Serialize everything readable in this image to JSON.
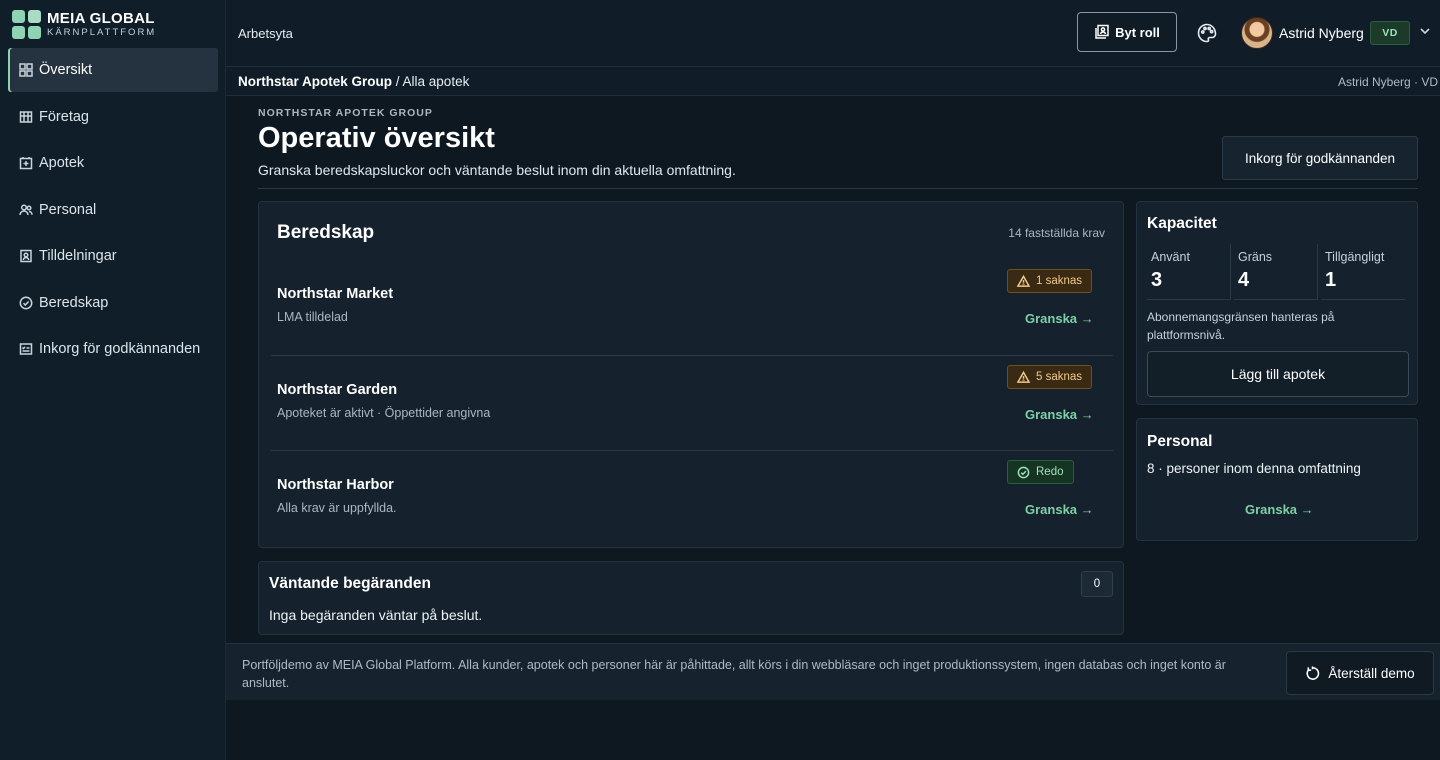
{
  "brand": {
    "name": "MEIA GLOBAL",
    "subtitle": "KÄRNPLATTFORM"
  },
  "sidebar": {
    "items": [
      {
        "label": "Översikt",
        "icon": "grid-icon",
        "active": true
      },
      {
        "label": "Företag",
        "icon": "building-icon"
      },
      {
        "label": "Apotek",
        "icon": "pharmacy-icon"
      },
      {
        "label": "Personal",
        "icon": "users-icon"
      },
      {
        "label": "Tilldelningar",
        "icon": "badge-icon"
      },
      {
        "label": "Beredskap",
        "icon": "check-circle-icon"
      },
      {
        "label": "Inkorg för godkännanden",
        "icon": "inbox-icon"
      }
    ]
  },
  "topbar": {
    "title": "Arbetsyta",
    "switch_role_label": "Byt roll",
    "user_name": "Astrid Nyberg",
    "user_role": "VD"
  },
  "breadcrumb": {
    "org": "Northstar Apotek Group",
    "separator": " / ",
    "current": "Alla apotek",
    "right": "Astrid Nyberg · VD"
  },
  "header": {
    "eyebrow": "NORTHSTAR APOTEK GROUP",
    "title": "Operativ översikt",
    "subtitle": "Granska beredskapsluckor och väntande beslut inom din aktuella omfattning.",
    "inbox_button": "Inkorg för godkännanden"
  },
  "readiness": {
    "title": "Beredskap",
    "requirements": "14 fastställda krav",
    "rows": [
      {
        "name": "Northstar Market",
        "desc": "LMA tilldelad",
        "badge": "1 saknas",
        "status": "warn",
        "link": "Granska →"
      },
      {
        "name": "Northstar Garden",
        "desc": "Apoteket är aktivt · Öppettider angivna",
        "badge": "5 saknas",
        "status": "warn",
        "link": "Granska →"
      },
      {
        "name": "Northstar Harbor",
        "desc": "Alla krav är uppfyllda.",
        "badge": "Redo",
        "status": "ok",
        "link": "Granska →"
      }
    ]
  },
  "pending": {
    "title": "Väntande begäranden",
    "count": "0",
    "empty": "Inga begäranden väntar på beslut."
  },
  "capacity": {
    "title": "Kapacitet",
    "stats": [
      {
        "label": "Använt",
        "value": "3"
      },
      {
        "label": "Gräns",
        "value": "4"
      },
      {
        "label": "Tillgängligt",
        "value": "1"
      }
    ],
    "note": "Abonnemangsgränsen hanteras på plattformsnivå.",
    "add_button": "Lägg till apotek"
  },
  "staff": {
    "title": "Personal",
    "count": "8 · personer inom denna omfattning",
    "link": "Granska →"
  },
  "footer": {
    "text": "Portföljdemo av MEIA Global Platform. Alla kunder, apotek och personer här är påhittade, allt körs i din webbläsare och inget produktionssystem, ingen databas och inget konto är anslutet.",
    "reset_button": "Återställ demo"
  },
  "colors": {
    "accent": "#7fcfa4",
    "warn": "#f0c98a",
    "ok": "#9ee0b9",
    "background": "#0e1821"
  }
}
